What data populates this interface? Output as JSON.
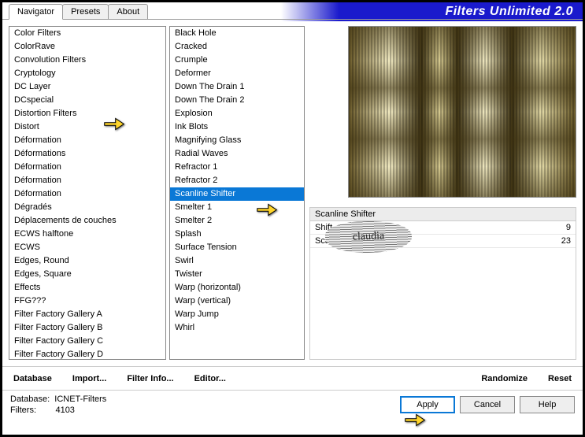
{
  "header": {
    "title": "Filters Unlimited 2.0"
  },
  "tabs": [
    {
      "label": "Navigator",
      "active": true
    },
    {
      "label": "Presets",
      "active": false
    },
    {
      "label": "About",
      "active": false
    }
  ],
  "categories": {
    "highlighted": "Distortion Filters",
    "items": [
      "Color Filters",
      "ColorRave",
      "Convolution Filters",
      "Cryptology",
      "DC Layer",
      "DCspecial",
      "Distortion Filters",
      "Distort",
      "Déformation",
      "Déformations",
      "Déformation",
      "Déformation",
      "Déformation",
      "Dégradés",
      "Déplacements de couches",
      "ECWS halftone",
      "ECWS",
      "Edges, Round",
      "Edges, Square",
      "Effects",
      "FFG???",
      "Filter Factory Gallery A",
      "Filter Factory Gallery B",
      "Filter Factory Gallery C",
      "Filter Factory Gallery D"
    ]
  },
  "filters": {
    "selected": "Scanline Shifter",
    "items": [
      "Black Hole",
      "Cracked",
      "Crumple",
      "Deformer",
      "Down The Drain 1",
      "Down The Drain 2",
      "Explosion",
      "Ink Blots",
      "Magnifying Glass",
      "Radial Waves",
      "Refractor 1",
      "Refractor 2",
      "Scanline Shifter",
      "Smelter 1",
      "Smelter 2",
      "Splash",
      "Surface Tension",
      "Swirl",
      "Twister",
      "Warp (horizontal)",
      "Warp (vertical)",
      "Warp Jump",
      "Whirl"
    ]
  },
  "current_filter": {
    "name": "Scanline Shifter",
    "params": [
      {
        "label": "Shift",
        "value": "9"
      },
      {
        "label": "Scanline Height",
        "value": "23"
      }
    ]
  },
  "bottom_links": {
    "database": "Database",
    "import": "Import...",
    "filter_info": "Filter Info...",
    "editor": "Editor...",
    "randomize": "Randomize",
    "reset": "Reset"
  },
  "status": {
    "database_label": "Database:",
    "database_value": "ICNET-Filters",
    "filters_label": "Filters:",
    "filters_value": "4103"
  },
  "actions": {
    "apply": "Apply",
    "cancel": "Cancel",
    "help": "Help"
  },
  "watermark": "claudia"
}
